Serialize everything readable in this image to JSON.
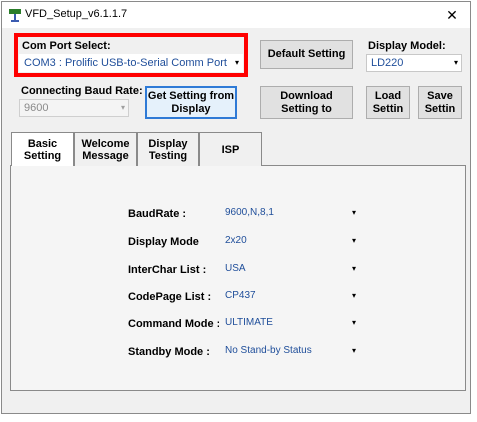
{
  "window": {
    "title": "VFD_Setup_v6.1.1.7",
    "close_glyph": "✕"
  },
  "com_port": {
    "label": "Com Port Select:",
    "value": "COM3 : Prolific USB-to-Serial Comm Port"
  },
  "baud": {
    "label": "Connecting Baud Rate:",
    "value": "9600"
  },
  "display_model": {
    "label": "Display Model:",
    "value": "LD220"
  },
  "buttons": {
    "default_setting": "Default Setting",
    "get_setting_line1": "Get Setting from",
    "get_setting_line2": "Display",
    "download_line1": "Download",
    "download_line2": "Setting to",
    "load_line1": "Load",
    "load_line2": "Settin",
    "save_line1": "Save",
    "save_line2": "Settin"
  },
  "tabs": [
    {
      "line1": "Basic",
      "line2": "Setting"
    },
    {
      "line1": "Welcome",
      "line2": "Message"
    },
    {
      "line1": "Display",
      "line2": "Testing"
    },
    {
      "line1": "ISP",
      "line2": ""
    }
  ],
  "settings": [
    {
      "label": "BaudRate :",
      "value": "9600,N,8,1"
    },
    {
      "label": "Display Mode",
      "value": "2x20"
    },
    {
      "label": "InterChar  List :",
      "value": "USA"
    },
    {
      "label": "CodePage List :",
      "value": "CP437"
    },
    {
      "label": "Command Mode :",
      "value": "ULTIMATE"
    },
    {
      "label": "Standby Mode :",
      "value": "No Stand-by Status"
    }
  ],
  "icons": {
    "app": "vfd-display-icon",
    "dropdown": "▾"
  }
}
